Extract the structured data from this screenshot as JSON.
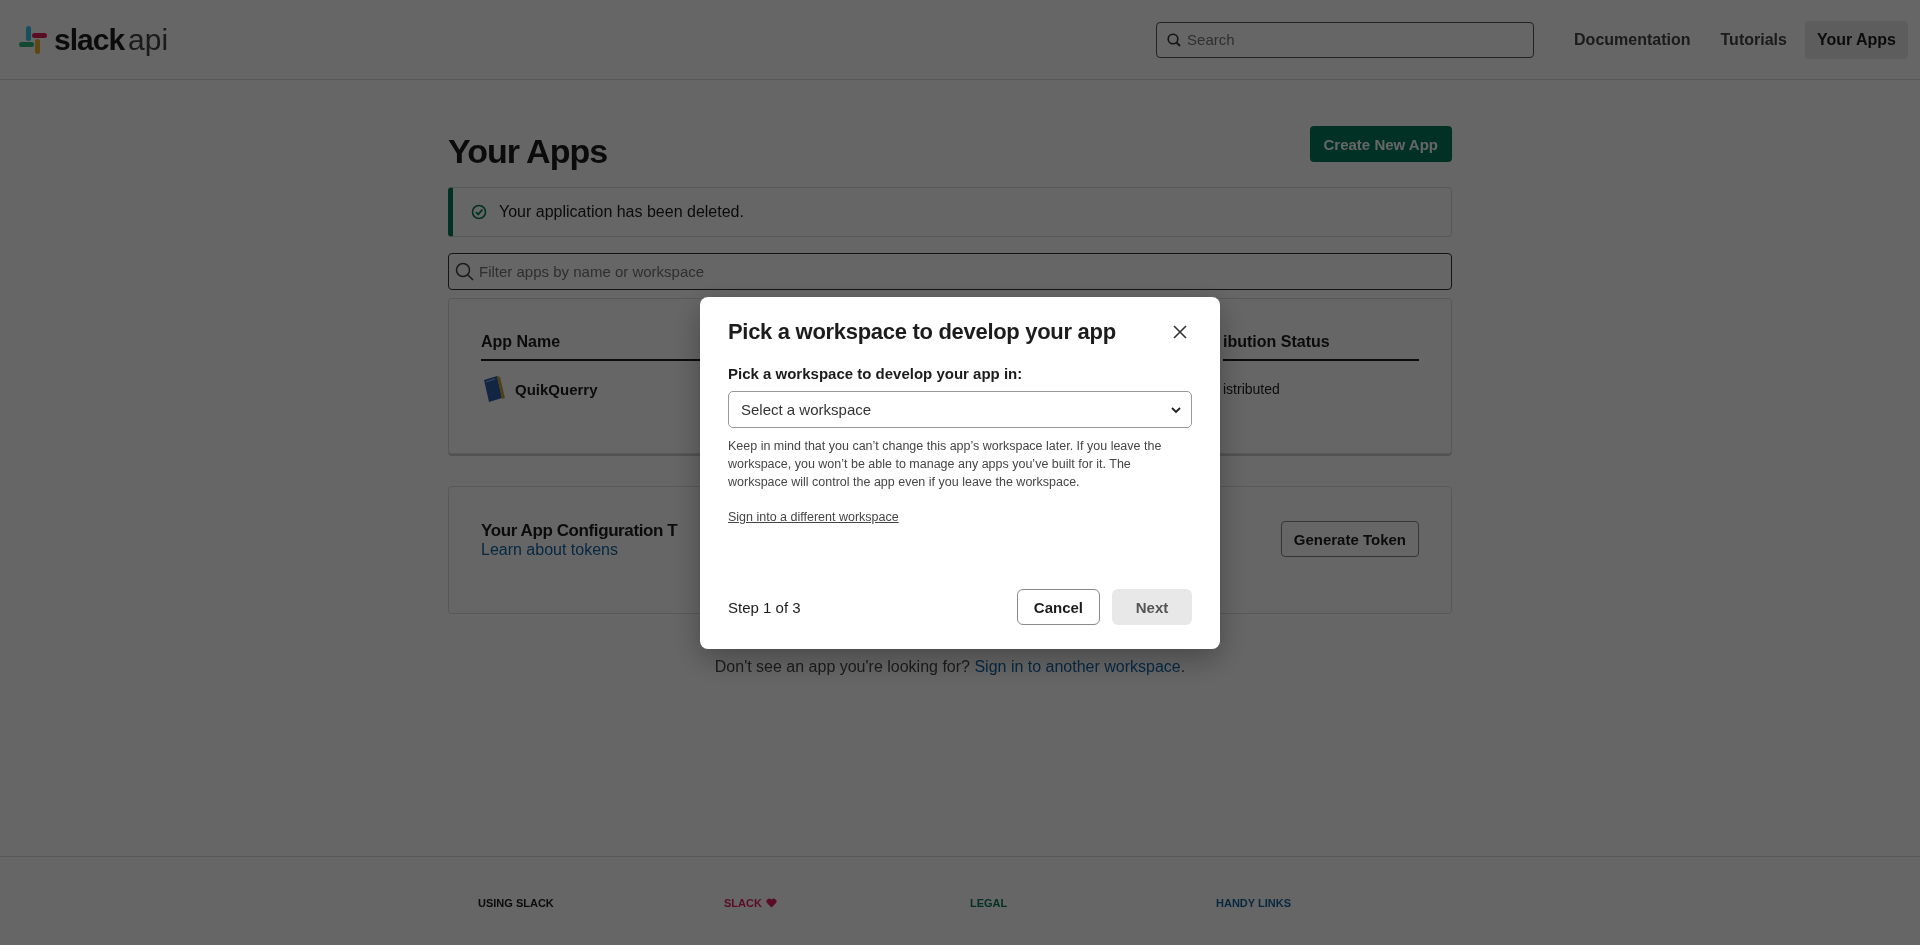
{
  "header": {
    "logo_text": "slack",
    "logo_suffix": "api",
    "search": {
      "placeholder": "Search"
    },
    "nav": [
      {
        "label": "Documentation",
        "selected": false
      },
      {
        "label": "Tutorials",
        "selected": false
      },
      {
        "label": "Your Apps",
        "selected": true
      }
    ]
  },
  "page": {
    "title": "Your Apps",
    "create_button": "Create New App",
    "alert": {
      "kind": "success",
      "message": "Your application has been deleted."
    },
    "filter": {
      "placeholder": "Filter apps by name or workspace"
    },
    "apps_table": {
      "columns": [
        "App Name",
        "ibution Status"
      ],
      "rows": [
        {
          "app_name": "QuikQuerry",
          "column_2": "istributed"
        }
      ]
    },
    "config_card": {
      "title": "Your App Configuration T",
      "link": "Learn about tokens",
      "button": "Generate Token"
    },
    "footer_note": {
      "text": "Don't see an app you're looking for?",
      "link": "Sign in to another workspace",
      "end": "."
    }
  },
  "footer": {
    "columns": [
      {
        "heading": "USING SLACK",
        "color": "#0c0b0c",
        "heart": false
      },
      {
        "heading": "SLACK",
        "color": "#5a0c24",
        "heart": true
      },
      {
        "heading": "LEGAL",
        "color": "#003124",
        "heart": false
      },
      {
        "heading": "HANDY LINKS",
        "color": "#072841",
        "heart": false
      }
    ]
  },
  "modal": {
    "title": "Pick a workspace to develop your app",
    "field_label": "Pick a workspace to develop your app in:",
    "select": {
      "placeholder": "Select a workspace"
    },
    "hint": "Keep in mind that you can’t change this app’s workspace later. If you leave the workspace, you won’t be able to manage any apps you’ve built for it. The workspace will control the app even if you leave the workspace.",
    "link": "Sign into a different workspace",
    "step": "Step 1 of 3",
    "buttons": [
      {
        "label": "Cancel",
        "kind": "secondary",
        "disabled": false
      },
      {
        "label": "Next",
        "kind": "primary",
        "disabled": true
      }
    ]
  }
}
